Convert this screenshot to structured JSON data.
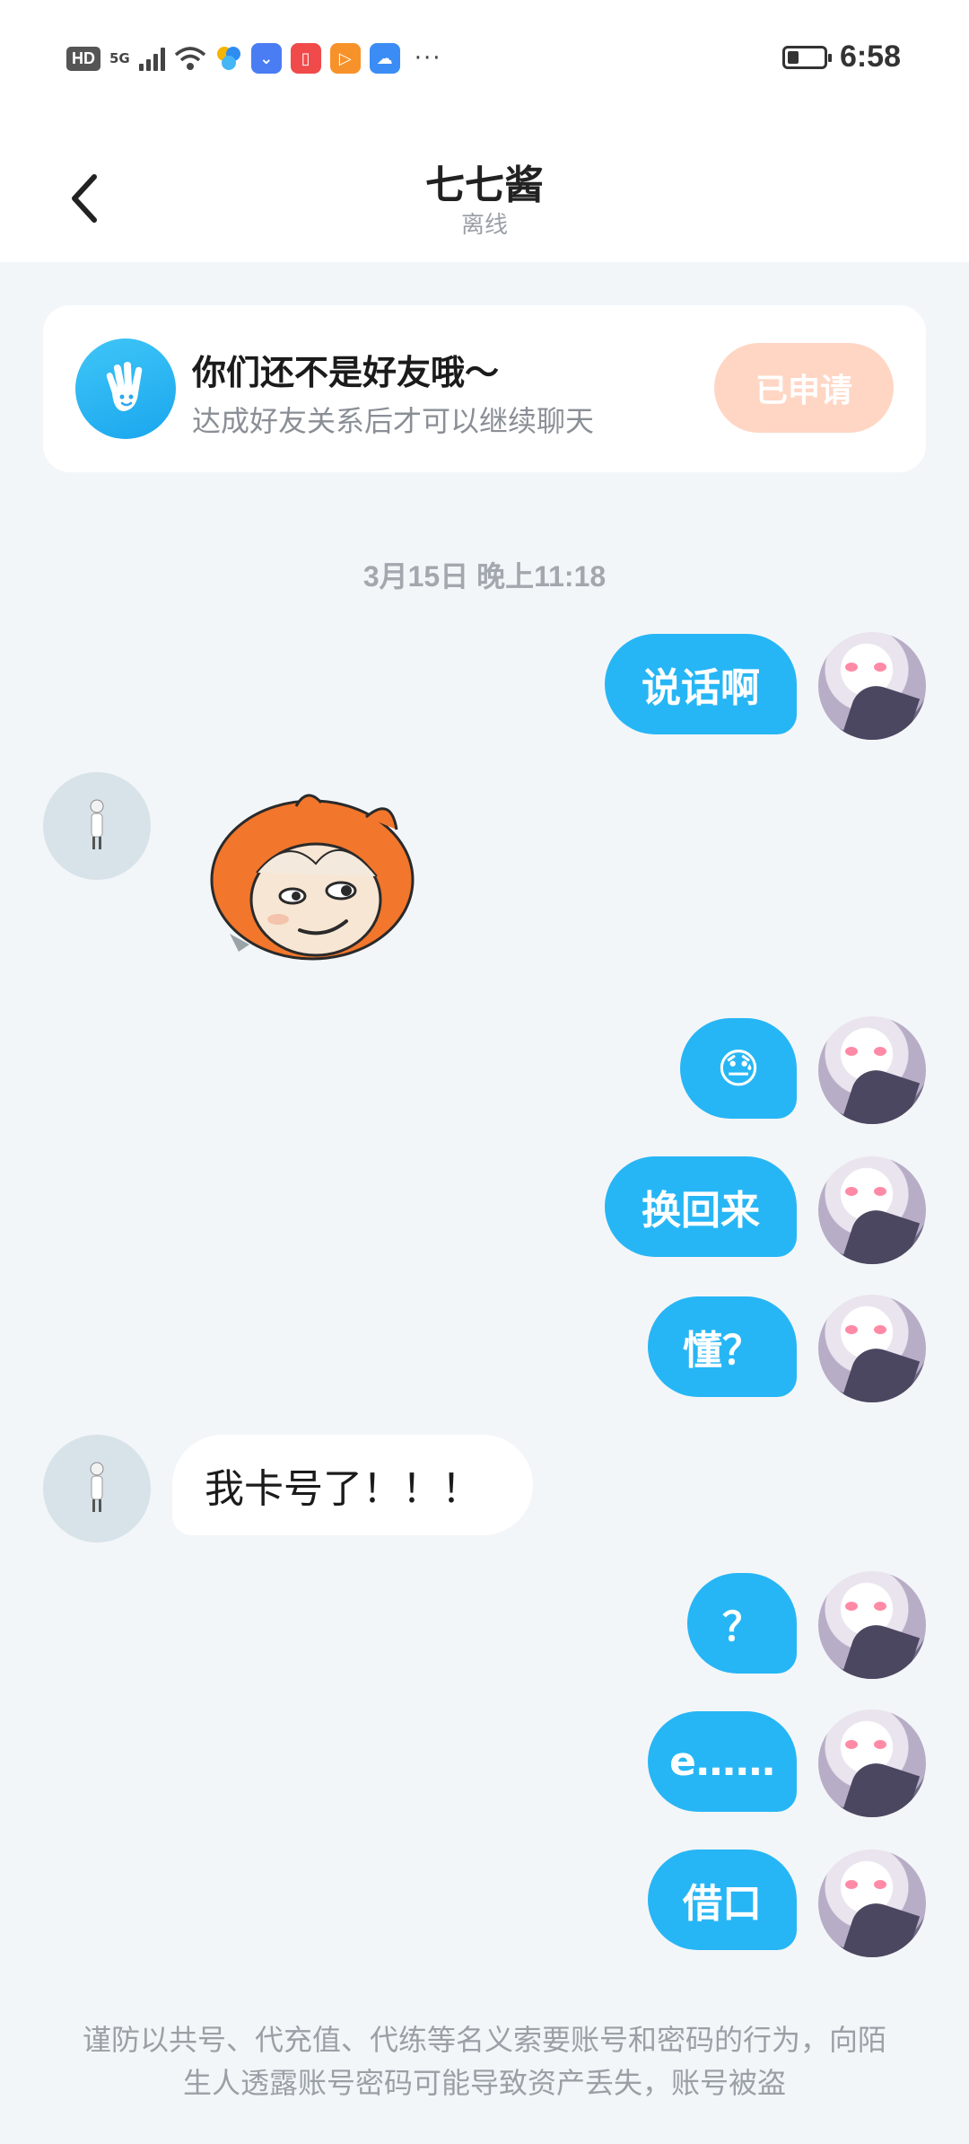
{
  "status_bar": {
    "hd": "HD",
    "network": "5G",
    "time": "6:58",
    "battery_level": 0.25,
    "dots": "···",
    "icons": [
      "signal-icon",
      "wifi-icon",
      "pinwheel-app-icon",
      "store-app-icon",
      "book-app-icon",
      "video-app-icon",
      "cloud-app-icon",
      "more-dots-icon",
      "battery-icon"
    ]
  },
  "header": {
    "title": "七七酱",
    "status": "离线"
  },
  "notice": {
    "title": "你们还不是好友哦～",
    "subtitle": "达成好友关系后才可以继续聊天",
    "button_label": "已申请",
    "icon": "hand-wave-icon"
  },
  "chat": {
    "timestamp": "3月15日 晚上11:18",
    "messages": [
      {
        "from": "me",
        "text": "说话啊"
      },
      {
        "from": "other",
        "type": "sticker",
        "sticker": "orange-hair-smirk-sticker"
      },
      {
        "from": "me",
        "text": "😓"
      },
      {
        "from": "me",
        "text": "换回来"
      },
      {
        "from": "me",
        "text": "懂？"
      },
      {
        "from": "other",
        "text": "我卡号了！！！"
      },
      {
        "from": "me",
        "text": "？"
      },
      {
        "from": "me",
        "text": "e……"
      },
      {
        "from": "me",
        "text": "借口"
      }
    ]
  },
  "footer": {
    "warning": "谨防以共号、代充值、代练等名义索要账号和密码的行为，向陌生人透露账号密码可能导致资产丢失，账号被盗"
  },
  "colors": {
    "accent_blue": "#27b6f5",
    "applied_button_bg": "#ffd6c4",
    "background": "#f3f6f9"
  }
}
